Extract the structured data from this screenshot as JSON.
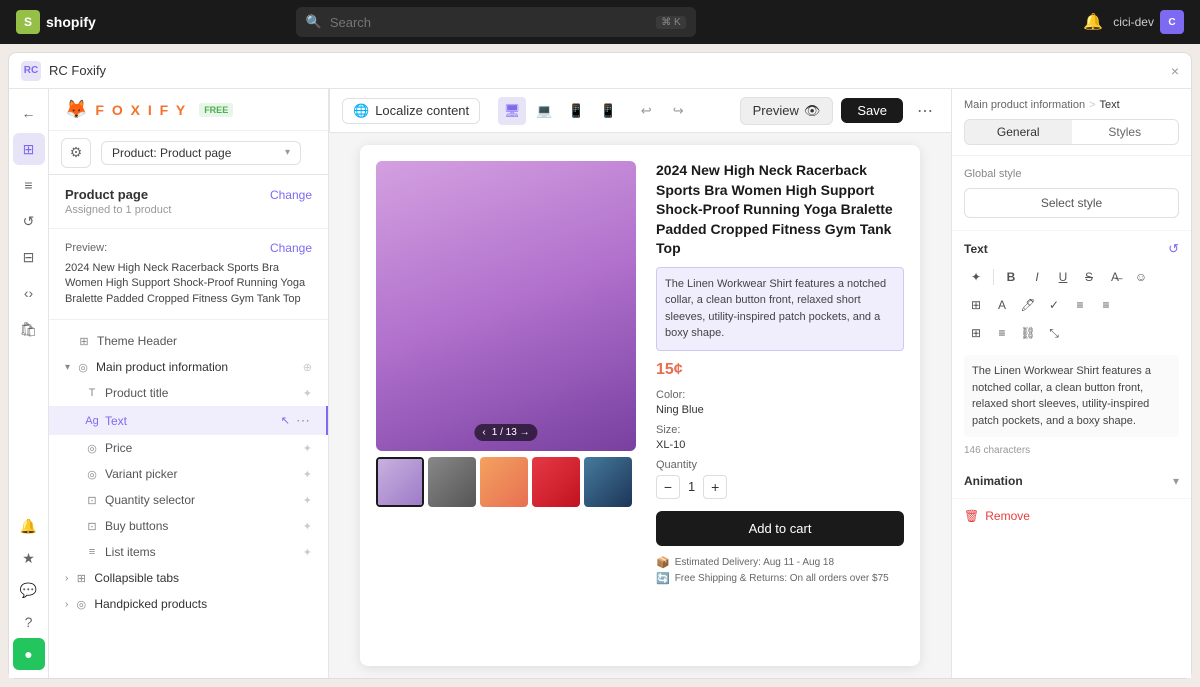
{
  "shopify_bar": {
    "logo_initial": "S",
    "logo_text": "shopify",
    "search_placeholder": "Search",
    "search_shortcut": "⌘ K",
    "user_name": "cici-dev",
    "user_initial": "C"
  },
  "app_window": {
    "title": "RC Foxify",
    "close": "×"
  },
  "toolbar": {
    "gear_icon": "⚙",
    "page_type": "Product: Product page",
    "localize_label": "Localize content",
    "devices": [
      "desktop",
      "tablet",
      "mobile",
      "watch"
    ],
    "preview_label": "Preview",
    "save_label": "Save",
    "more_icon": "⋯"
  },
  "foxify": {
    "fox_icon": "🦊",
    "text": "FOXIFY",
    "badge": "FREE"
  },
  "left_panel": {
    "page_title": "Product page",
    "change_label": "Change",
    "assigned_to": "Assigned to 1 product",
    "preview_label": "Preview:",
    "preview_change": "Change",
    "preview_product": "2024 New High Neck Racerback Sports Bra Women High Support Shock-Proof Running Yoga Bralette Padded Cropped Fitness Gym Tank Top",
    "tree_items": [
      {
        "id": "theme-header",
        "label": "Theme Header",
        "indent": 0,
        "icon": "⊞",
        "type": "section"
      },
      {
        "id": "main-product-info",
        "label": "Main product information",
        "indent": 0,
        "icon": "◎",
        "type": "group",
        "expanded": true
      },
      {
        "id": "product-title",
        "label": "Product title",
        "indent": 1,
        "icon": "T",
        "type": "item"
      },
      {
        "id": "text",
        "label": "Text",
        "indent": 1,
        "icon": "Ag",
        "type": "item",
        "active": true
      },
      {
        "id": "price",
        "label": "Price",
        "indent": 1,
        "icon": "◎",
        "type": "item"
      },
      {
        "id": "variant-picker",
        "label": "Variant picker",
        "indent": 1,
        "icon": "◎",
        "type": "item"
      },
      {
        "id": "quantity-selector",
        "label": "Quantity selector",
        "indent": 1,
        "icon": "⊡",
        "type": "item"
      },
      {
        "id": "buy-buttons",
        "label": "Buy buttons",
        "indent": 1,
        "icon": "⊡",
        "type": "item"
      },
      {
        "id": "list-items",
        "label": "List items",
        "indent": 1,
        "icon": "≡",
        "type": "item"
      },
      {
        "id": "collapsible-tabs",
        "label": "Collapsible tabs",
        "indent": 0,
        "icon": "⊞",
        "type": "group"
      },
      {
        "id": "handpicked-products",
        "label": "Handpicked products",
        "indent": 0,
        "icon": "◎",
        "type": "group"
      }
    ]
  },
  "product": {
    "title": "2024 New High Neck Racerback Sports Bra Women High Support Shock-Proof Running Yoga Bralette Padded Cropped Fitness Gym Tank Top",
    "description": "The Linen Workwear Shirt features a notched collar, a clean button front, relaxed short sleeves, utility-inspired patch pockets, and a boxy shape.",
    "price": "15¢",
    "color_label": "Color:",
    "color_value": "Ning Blue",
    "size_label": "Size:",
    "size_value": "XL-10",
    "quantity_label": "Quantity",
    "quantity_value": "1",
    "add_to_cart": "Add to cart",
    "delivery_label": "Estimated Delivery: Aug 11 - Aug 18",
    "shipping_label": "Free Shipping & Returns: On all orders over $75",
    "image_nav": "1 / 13 →"
  },
  "right_panel": {
    "breadcrumb": [
      "Main product information",
      ">",
      "Text"
    ],
    "tabs": [
      "General",
      "Styles"
    ],
    "global_style_label": "Global style",
    "select_style_label": "Select style",
    "text_section_label": "Text",
    "text_preview": "The Linen Workwear Shirt features a notched collar, a clean button front, relaxed short sleeves, utility-inspired patch pockets, and a boxy shape.",
    "char_count": "146 characters",
    "animation_label": "Animation",
    "remove_label": "Remove",
    "toolbar_buttons": [
      "✦",
      "B",
      "I",
      "U",
      "S",
      "A̶",
      "☺",
      "⊞",
      "A",
      "🖊",
      "✓",
      "≡",
      "≡",
      "⊞",
      "≡",
      "⛓",
      "⤡"
    ]
  }
}
